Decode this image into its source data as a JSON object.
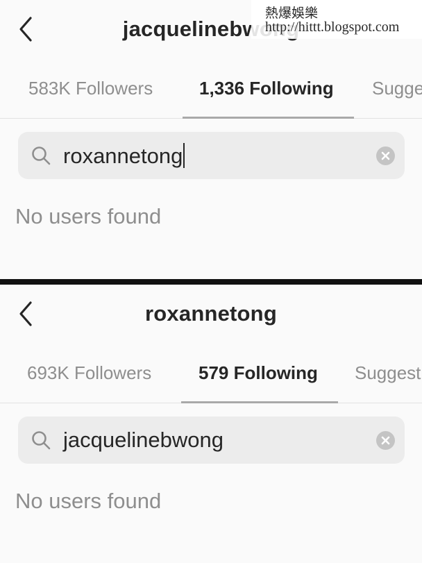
{
  "watermark": {
    "line1": "熱爆娛樂",
    "line2": "http://hittt.blogspot.com"
  },
  "screens": [
    {
      "title": "jacquelinebwong",
      "tabs": {
        "followers": "583K Followers",
        "following": "1,336 Following",
        "suggested": "Sugge"
      },
      "active_tab": "following",
      "search": {
        "value": "roxannetong",
        "caret_visible": true
      },
      "empty_message": "No users found"
    },
    {
      "title": "roxannetong",
      "tabs": {
        "followers": "693K Followers",
        "following": "579 Following",
        "suggested": "Suggest"
      },
      "active_tab": "following",
      "search": {
        "value": "jacquelinebwong",
        "caret_visible": false
      },
      "empty_message": "No users found"
    }
  ],
  "icons": {
    "back": "chevron-left-icon",
    "search": "magnifier-icon",
    "clear": "clear-x-icon"
  },
  "colors": {
    "background": "#fafafa",
    "text_primary": "#262626",
    "text_secondary": "#8e8e8e",
    "search_field": "#ececec",
    "divider": "#111111"
  }
}
